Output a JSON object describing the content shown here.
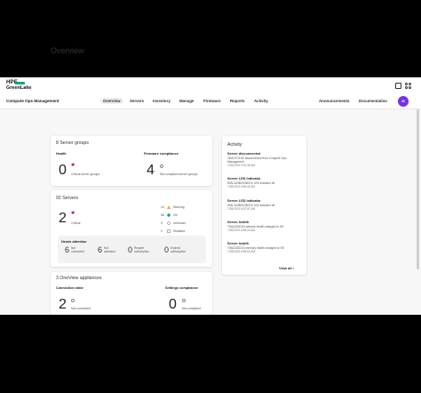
{
  "brand": {
    "line1": "HPE",
    "line2": "GreenLake"
  },
  "app_name": "Compute Ops Management",
  "nav": [
    {
      "label": "Overview",
      "active": true
    },
    {
      "label": "Servers"
    },
    {
      "label": "Inventory"
    },
    {
      "label": "Manage"
    },
    {
      "label": "Firmware"
    },
    {
      "label": "Reports"
    },
    {
      "label": "Activity"
    }
  ],
  "nav_right": {
    "announcements": "Announcements",
    "documentation": "Documentation"
  },
  "avatar_initials": "M",
  "page_title": "Overview",
  "server_groups": {
    "title": "8 Server groups",
    "health_label": "Health",
    "health_count": "0",
    "health_sub": "Critical server groups",
    "fw_label": "Firmware compliance",
    "fw_count": "4",
    "fw_sub": "Not compliant server groups"
  },
  "servers": {
    "title": "92 Servers",
    "critical_count": "2",
    "critical_label": "Critical",
    "legend": [
      {
        "count": "24",
        "label": "Warning",
        "color": "#f5a623"
      },
      {
        "count": "66",
        "label": "OK",
        "color": "#01a982"
      },
      {
        "count": "0",
        "label": "Unknown",
        "color": "#999999"
      },
      {
        "count": "0",
        "label": "Disabled",
        "color": "#999999"
      }
    ],
    "attention_title": "Needs attention",
    "attention": [
      {
        "count": "6",
        "label1": "Not",
        "label2": "connected"
      },
      {
        "count": "6",
        "label1": "Not",
        "label2": "activated"
      },
      {
        "count": "0",
        "label1": "Require",
        "label2": "subscription"
      },
      {
        "count": "0",
        "label1": "Expired",
        "label2": "subscription"
      }
    ]
  },
  "oneview": {
    "title": "3 OneView appliances",
    "conn_label": "Connection state",
    "conn_count": "2",
    "conn_sub": "Not connected",
    "settings_label": "Settings compliance",
    "settings_count": "0",
    "settings_sub": "Not compliant"
  },
  "activity": {
    "title": "Activity",
    "items": [
      {
        "title": "Server disconnected",
        "desc": "2M3O7O1KK disconnected from Compute Ops Management",
        "date": "7/28/2023 9:02:36 AM"
      },
      {
        "title": "Server LED indicator",
        "desc": "WIN-2A3B2K3BX1K LED indicator off",
        "date": "7/28/2023 8:59:45 AM"
      },
      {
        "title": "Server LED indicator",
        "desc": "WIN-2A3B2K3BX1K LED indicator off",
        "date": "7/28/2023 8:57:57 AM"
      },
      {
        "title": "Server health",
        "desc": "TWA23251S4 network health changed to OK",
        "date": "7/28/2023 8:56:44 AM"
      },
      {
        "title": "Server health",
        "desc": "TWA23251S4 memory health changed to OK",
        "date": "7/28/2023 8:55:53 AM"
      }
    ],
    "view_all": "View all"
  }
}
